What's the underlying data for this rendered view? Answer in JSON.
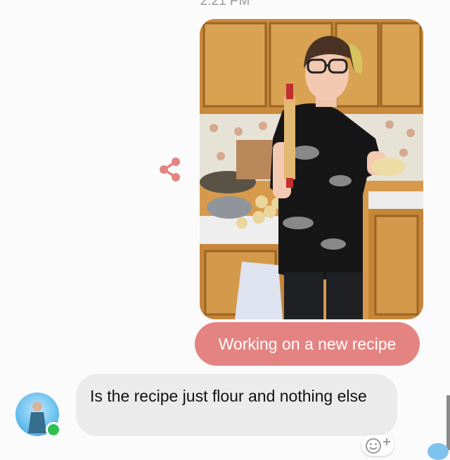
{
  "timestamp": "2:21 PM",
  "outgoing": {
    "caption": "Working on a new recipe",
    "bubble_color": "#e48482"
  },
  "incoming": {
    "text": "Is the recipe just flour and nothing else",
    "bubble_color": "#ebebeb"
  },
  "icons": {
    "share": "share-icon",
    "emoji_reaction": "add-reaction-icon",
    "presence": "online-status-dot"
  },
  "colors": {
    "share_icon": "#e48482",
    "online": "#30c04f"
  }
}
